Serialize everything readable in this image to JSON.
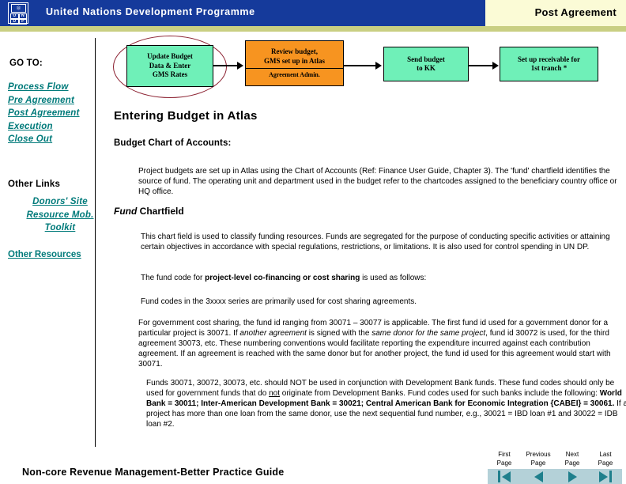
{
  "banner": {
    "logo_alt": "undp-logo",
    "logo_letters": [
      "U",
      "N",
      "D",
      "P"
    ],
    "org_title": "United Nations Development Programme",
    "section_title": "Post Agreement"
  },
  "sidebar": {
    "goto_label": "GO TO:",
    "links": [
      {
        "label": "Process Flow"
      },
      {
        "label": "Pre Agreement"
      },
      {
        "label": "Post Agreement"
      },
      {
        "label": "Execution"
      },
      {
        "label": "Close Out"
      }
    ],
    "other_links_label": "Other Links",
    "other_links": [
      {
        "label": "Donors' Site"
      },
      {
        "label": "Resource Mob."
      },
      {
        "label": "Toolkit"
      }
    ],
    "other_resources_label": "Other Resources"
  },
  "flowchart": {
    "steps": [
      {
        "name": "update-budget",
        "lines": [
          "Update Budget",
          "Data & Enter",
          "GMS Rates"
        ],
        "sub": "",
        "color": "#6ff0b8",
        "highlighted": true
      },
      {
        "name": "review-budget",
        "lines": [
          "Review budget,",
          "GMS set up in Atlas"
        ],
        "sub": "Agreement Admin.",
        "color": "#f79420",
        "highlighted": false
      },
      {
        "name": "send-budget",
        "lines": [
          "Send budget",
          "to KK"
        ],
        "sub": "",
        "color": "#6ff0b8",
        "highlighted": false
      },
      {
        "name": "set-up-receivable",
        "lines": [
          "Set up receivable for",
          "1st tranch *"
        ],
        "sub": "",
        "color": "#6ff0b8",
        "highlighted": false
      }
    ]
  },
  "main": {
    "heading": "Entering Budget in Atlas",
    "subheading": "Budget Chart of Accounts:",
    "paragraph_1": "Project budgets are set up in Atlas using the Chart of Accounts (Ref: Finance User Guide, Chapter 3). The 'fund' chartfield identifies the source of fund.   The operating unit and department  used in the budget refer to the chartcodes assigned to the beneficiary country office or HQ office.",
    "fund_chartfield_italic": "Fund",
    "fund_chartfield_rest": " Chartfield",
    "paragraph_2": "This chart field is used to classify funding resources.  Funds are segregated  for the purpose of conducting specific activities or attaining certain objectives in accordance with  special regulations, restrictions, or limitations.  It is also used for control spending in UN DP.",
    "paragraph_3_prefix": "The fund  code for ",
    "paragraph_3_bold": "project-level co-financing or cost sharing",
    "paragraph_3_suffix": " is used as follows:",
    "paragraph_4": "Fund codes in the 3xxxx series are primarily used for cost sharing agreements.",
    "paragraph_5_a": "For government cost sharing, the fund id ranging from 30071 – 30077 is applicable.  The first fund id  used for a government donor for a particular project is 30071.  If ",
    "paragraph_5_i1": "another agreement",
    "paragraph_5_b": " is signed  with  the ",
    "paragraph_5_i2": "same donor for the same project",
    "paragraph_5_c": ", fund id 30072 is used, for the third agreement 30073, etc. These numbering conventions would facilitate reporting the expenditure incurred against each contribution agreement.  If an agreement is reached with the same donor but for another project, the fund id used for this agreement would start with 30071.",
    "paragraph_6_a": "Funds 30071, 30072, 30073, etc. should NOT  be used in conjunction with Development Bank funds.  These fund codes should only be  used for government funds that do ",
    "paragraph_6_u": "not",
    "paragraph_6_b": " originate from Development Banks.   Fund codes used for such banks  include the following: ",
    "paragraph_6_bold": "World Bank = 30011; Inter-American Development Bank = 30021; Central American Bank for Economic Integration {CABEI} = 30061.",
    "paragraph_6_c": " If a project has more than one loan from the same donor, use the next sequential fund number, e.g., 30021 = IBD loan #1 and 30022 = IDB loan #2."
  },
  "footer": {
    "title": "Non-core Revenue Management-Better Practice Guide",
    "pager": [
      {
        "name": "first-page",
        "label_line1": "First",
        "label_line2": "Page",
        "icon": "first-page-icon"
      },
      {
        "name": "previous-page",
        "label_line1": "Previous",
        "label_line2": "Page",
        "icon": "previous-page-icon"
      },
      {
        "name": "next-page",
        "label_line1": "Next",
        "label_line2": "Page",
        "icon": "next-page-icon"
      },
      {
        "name": "last-page",
        "label_line1": "Last",
        "label_line2": "Page",
        "icon": "last-page-icon"
      }
    ]
  },
  "colors": {
    "banner_blue": "#153a9b",
    "banner_right_cream": "#fbfbd6",
    "yellow_strip": "#c9cf82",
    "link_teal": "#007a7a",
    "box_orange": "#f79420",
    "box_green": "#6ff0b8",
    "oval_red": "#8b2030",
    "pager_bar": "#b4d1d8",
    "pager_arrow": "#1f7f8c"
  }
}
